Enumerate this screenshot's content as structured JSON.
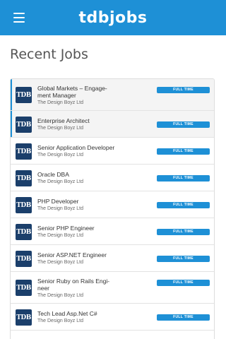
{
  "colors": {
    "brand": "#1e90d6",
    "logo_bg": "#1b3f6b"
  },
  "app_bar": {
    "title": "tdbjobs",
    "menu_icon": "hamburger-menu-icon"
  },
  "page": {
    "title": "Recent Jobs"
  },
  "jobs": [
    {
      "title": "Global Markets – Engage-\nment Manager",
      "company": "The Design Boyz Ltd",
      "type": "FULL TIME",
      "logo": "TDB",
      "selected": true
    },
    {
      "title": "Enterprise Architect",
      "company": "The Design Boyz Ltd",
      "type": "FULL TIME",
      "logo": "TDB",
      "selected": true
    },
    {
      "title": "Senior Application Developer",
      "company": "The Design Boyz Ltd",
      "type": "FULL TIME",
      "logo": "TDB",
      "selected": false
    },
    {
      "title": "Oracle DBA",
      "company": "The Design Boyz Ltd",
      "type": "FULL TIME",
      "logo": "TDB",
      "selected": false
    },
    {
      "title": "PHP Developer",
      "company": "The Design Boyz Ltd",
      "type": "FULL TIME",
      "logo": "TDB",
      "selected": false
    },
    {
      "title": "Senior PHP Engineer",
      "company": "The Design Boyz Ltd",
      "type": "FULL TIME",
      "logo": "TDB",
      "selected": false
    },
    {
      "title": "Senior ASP.NET Engineer",
      "company": "The Design Boyz Ltd",
      "type": "FULL TIME",
      "logo": "TDB",
      "selected": false
    },
    {
      "title": "Senior Ruby on Rails Engi-\nneer",
      "company": "The Design Boyz Ltd",
      "type": "FULL TIME",
      "logo": "TDB",
      "selected": false
    },
    {
      "title": "Tech Lead Asp.Net C#",
      "company": "The Design Boyz Ltd",
      "type": "FULL TIME",
      "logo": "TDB",
      "selected": false
    }
  ]
}
